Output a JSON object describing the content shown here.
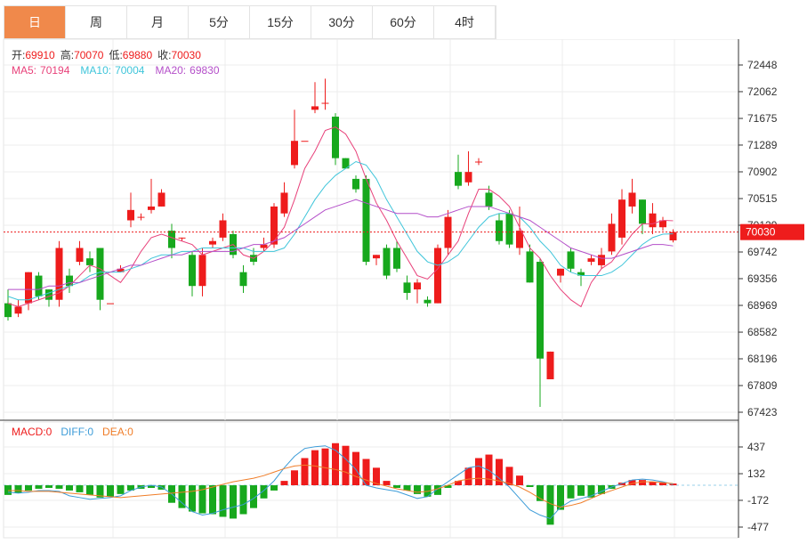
{
  "tabs": [
    {
      "label": "日",
      "active": true
    },
    {
      "label": "周",
      "active": false
    },
    {
      "label": "月",
      "active": false
    },
    {
      "label": "5分",
      "active": false
    },
    {
      "label": "15分",
      "active": false
    },
    {
      "label": "30分",
      "active": false
    },
    {
      "label": "60分",
      "active": false
    },
    {
      "label": "4时",
      "active": false
    }
  ],
  "ohlc_info": {
    "open_label": "开:",
    "open": "69910",
    "high_label": "高:",
    "high": "70070",
    "low_label": "低:",
    "low": "69880",
    "close_label": "收:",
    "close": "70030"
  },
  "ma_info": {
    "ma5_label": "MA5:",
    "ma5": "70194",
    "ma10_label": "MA10:",
    "ma10": "70004",
    "ma20_label": "MA20:",
    "ma20": "69830"
  },
  "macd_info": {
    "macd_label": "MACD:",
    "macd": "0",
    "diff_label": "DIFF:",
    "diff": "0",
    "dea_label": "DEA:",
    "dea": "0"
  },
  "colors": {
    "up": "#ee1c1c",
    "down": "#17a81d",
    "ma5": "#e8417a",
    "ma10": "#3fc5da",
    "ma20": "#b44fc9",
    "diff": "#3d9cd8",
    "dea": "#f07d28",
    "price_tag": "#ee1c1c",
    "active_tab": "#f0894b"
  },
  "chart_data": {
    "type": "candlestick",
    "price_axis_ticks": [
      "72448",
      "72062",
      "71675",
      "71289",
      "70902",
      "70515",
      "70129",
      "69742",
      "69356",
      "68969",
      "68582",
      "68196",
      "67809",
      "67423"
    ],
    "price_axis_values": [
      72448,
      72062,
      71675,
      71289,
      70902,
      70515,
      70129,
      69742,
      69356,
      68969,
      68582,
      68196,
      67809,
      67423
    ],
    "current_price": "70030",
    "candles": [
      [
        69000,
        68800,
        69200,
        68750
      ],
      [
        68850,
        68950,
        69050,
        68800
      ],
      [
        69000,
        69450,
        69450,
        68900
      ],
      [
        69400,
        69100,
        69450,
        69050
      ],
      [
        69200,
        69050,
        69200,
        68950
      ],
      [
        69050,
        69800,
        69900,
        68950
      ],
      [
        69400,
        69250,
        69500,
        69150
      ],
      [
        69600,
        69800,
        69900,
        69550
      ],
      [
        69650,
        69550,
        69750,
        69450
      ],
      [
        69800,
        69050,
        69800,
        68900
      ],
      [
        69000,
        69000,
        69000,
        69000
      ],
      [
        69450,
        69500,
        69550,
        69450
      ],
      [
        70200,
        70350,
        70600,
        70100
      ],
      [
        70250,
        70250,
        70300,
        70200
      ],
      [
        70350,
        70400,
        70800,
        70300
      ],
      [
        70400,
        70600,
        70650,
        70400
      ],
      [
        70050,
        69800,
        70150,
        69650
      ],
      [
        69950,
        69950,
        69950,
        69900
      ],
      [
        69700,
        69250,
        69750,
        69100
      ],
      [
        69250,
        69700,
        69800,
        69100
      ],
      [
        69850,
        69900,
        69950,
        69800
      ],
      [
        69950,
        70200,
        70300,
        69900
      ],
      [
        70000,
        69700,
        70050,
        69650
      ],
      [
        69450,
        69250,
        69550,
        69150
      ],
      [
        69700,
        69600,
        69800,
        69550
      ],
      [
        69800,
        69850,
        69950,
        69750
      ],
      [
        69850,
        70400,
        70450,
        69800
      ],
      [
        70300,
        70600,
        70750,
        70250
      ],
      [
        71000,
        71350,
        71800,
        70950
      ],
      [
        71350,
        71350,
        71350,
        71350
      ],
      [
        71800,
        71850,
        72200,
        71750
      ],
      [
        71900,
        71900,
        72250,
        71800
      ],
      [
        71700,
        71100,
        71750,
        71000
      ],
      [
        71100,
        70950,
        71100,
        70950
      ],
      [
        70800,
        70650,
        70850,
        70600
      ],
      [
        70800,
        69600,
        70850,
        69550
      ],
      [
        69650,
        69700,
        69700,
        69550
      ],
      [
        69800,
        69400,
        69850,
        69350
      ],
      [
        69800,
        69500,
        69900,
        69450
      ],
      [
        69300,
        69150,
        69400,
        69050
      ],
      [
        69200,
        69300,
        69350,
        69000
      ],
      [
        69050,
        69000,
        69100,
        68950
      ],
      [
        69000,
        69800,
        69850,
        69000
      ],
      [
        69800,
        70250,
        70350,
        69700
      ],
      [
        70900,
        70700,
        71150,
        70650
      ],
      [
        70750,
        70900,
        71200,
        70700
      ],
      [
        71050,
        71050,
        71100,
        71000
      ],
      [
        70600,
        70400,
        70700,
        70350
      ],
      [
        70200,
        69900,
        70300,
        69850
      ],
      [
        70300,
        69850,
        70350,
        69800
      ],
      [
        69800,
        70050,
        70400,
        69700
      ],
      [
        69750,
        69300,
        69850,
        69300
      ],
      [
        69600,
        68200,
        69650,
        67500
      ],
      [
        67900,
        68300,
        68300,
        67900
      ],
      [
        69400,
        69500,
        69500,
        69300
      ],
      [
        69750,
        69500,
        69800,
        69450
      ],
      [
        69450,
        69400,
        69500,
        69250
      ],
      [
        69600,
        69650,
        69700,
        69550
      ],
      [
        69550,
        69700,
        69800,
        69500
      ],
      [
        69750,
        70150,
        70300,
        69700
      ],
      [
        69950,
        70500,
        70650,
        69850
      ],
      [
        70400,
        70600,
        70800,
        70300
      ],
      [
        70500,
        70150,
        70500,
        70000
      ],
      [
        70100,
        70300,
        70450,
        70000
      ],
      [
        70100,
        70200,
        70250,
        70050
      ],
      [
        69910,
        70030,
        70070,
        69880
      ]
    ],
    "ma5": [
      69000,
      68950,
      69000,
      69050,
      69100,
      69150,
      69250,
      69400,
      69550,
      69500,
      69400,
      69300,
      69500,
      69750,
      69950,
      70000,
      69950,
      69900,
      69850,
      69700,
      69750,
      69800,
      69850,
      69700,
      69650,
      69750,
      69900,
      70100,
      70500,
      70950,
      71200,
      71500,
      71550,
      71450,
      71200,
      70800,
      70450,
      70200,
      69900,
      69650,
      69400,
      69350,
      69500,
      69700,
      69900,
      70300,
      70650,
      70650,
      70550,
      70400,
      70100,
      69800,
      69650,
      69400,
      69200,
      69050,
      68950,
      69300,
      69500,
      69600,
      69800,
      70000,
      70150,
      70150,
      70200,
      70194
    ],
    "ma10": [
      69100,
      69050,
      69050,
      69100,
      69150,
      69200,
      69250,
      69300,
      69400,
      69450,
      69450,
      69450,
      69500,
      69550,
      69650,
      69700,
      69700,
      69750,
      69750,
      69800,
      69800,
      69800,
      69800,
      69800,
      69750,
      69750,
      69750,
      69800,
      70000,
      70250,
      70500,
      70700,
      70850,
      70950,
      71050,
      71000,
      70800,
      70500,
      70250,
      70000,
      69750,
      69600,
      69550,
      69600,
      69700,
      69900,
      70100,
      70250,
      70300,
      70300,
      70250,
      70100,
      69900,
      69750,
      69550,
      69450,
      69400,
      69400,
      69400,
      69450,
      69550,
      69700,
      69850,
      69950,
      70000,
      70004
    ],
    "ma20": [
      69200,
      69200,
      69200,
      69200,
      69250,
      69250,
      69300,
      69300,
      69350,
      69400,
      69450,
      69500,
      69550,
      69550,
      69600,
      69650,
      69700,
      69700,
      69750,
      69750,
      69750,
      69750,
      69750,
      69800,
      69850,
      69850,
      69900,
      69950,
      70050,
      70150,
      70250,
      70350,
      70400,
      70450,
      70500,
      70450,
      70400,
      70350,
      70300,
      70300,
      70300,
      70250,
      70250,
      70300,
      70350,
      70400,
      70400,
      70400,
      70350,
      70300,
      70250,
      70200,
      70100,
      70000,
      69900,
      69800,
      69750,
      69700,
      69650,
      69650,
      69700,
      69750,
      69800,
      69850,
      69850,
      69830
    ],
    "macd_axis_ticks": [
      "437",
      "132",
      "-172",
      "-477"
    ],
    "macd_axis_values": [
      437,
      132,
      -172,
      -477
    ],
    "macd_hist": [
      -110,
      -90,
      -60,
      -40,
      -30,
      -40,
      -60,
      -80,
      -110,
      -140,
      -130,
      -100,
      -60,
      -40,
      -30,
      -50,
      -200,
      -260,
      -300,
      -320,
      -330,
      -360,
      -380,
      -330,
      -260,
      -150,
      -60,
      50,
      170,
      310,
      400,
      420,
      480,
      450,
      380,
      300,
      200,
      50,
      -30,
      -60,
      -100,
      -130,
      -110,
      -30,
      50,
      200,
      310,
      350,
      300,
      210,
      110,
      -20,
      -180,
      -450,
      -280,
      -150,
      -120,
      -140,
      -100,
      -40,
      30,
      60,
      60,
      40,
      30,
      20
    ],
    "macd_diff": [
      -80,
      -90,
      -80,
      -60,
      -60,
      -70,
      -120,
      -140,
      -160,
      -150,
      -140,
      -120,
      -60,
      -20,
      0,
      -20,
      -100,
      -200,
      -300,
      -340,
      -320,
      -280,
      -250,
      -220,
      -150,
      -60,
      50,
      200,
      330,
      420,
      440,
      450,
      400,
      300,
      180,
      0,
      -30,
      -50,
      -70,
      -110,
      -150,
      -130,
      -40,
      40,
      120,
      200,
      220,
      170,
      80,
      -20,
      -150,
      -280,
      -340,
      -380,
      -250,
      -180,
      -150,
      -120,
      -70,
      -20,
      20,
      60,
      70,
      60,
      40,
      10
    ],
    "macd_dea": [
      -60,
      -60,
      -70,
      -70,
      -70,
      -80,
      -90,
      -100,
      -110,
      -120,
      -130,
      -140,
      -130,
      -120,
      -110,
      -100,
      -90,
      -80,
      -70,
      -50,
      -20,
      10,
      40,
      60,
      80,
      110,
      150,
      190,
      220,
      230,
      220,
      200,
      180,
      150,
      100,
      60,
      20,
      -10,
      -40,
      -60,
      -80,
      -70,
      -40,
      0,
      50,
      70,
      80,
      70,
      50,
      20,
      -20,
      -80,
      -150,
      -210,
      -250,
      -230,
      -200,
      -150,
      -100,
      -60,
      -20,
      20,
      40,
      40,
      30,
      20
    ]
  }
}
